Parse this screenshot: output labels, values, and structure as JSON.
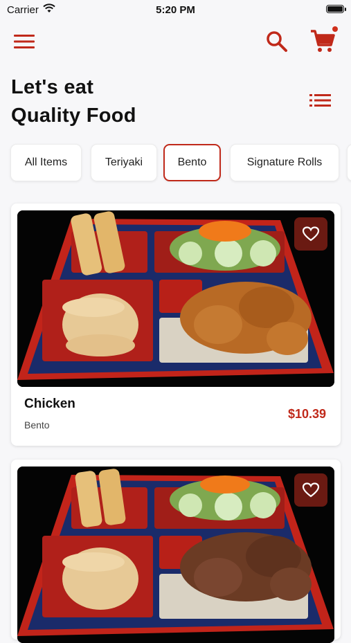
{
  "status_bar": {
    "carrier": "Carrier",
    "time": "5:20 PM"
  },
  "header": {
    "menu_icon": "hamburger-menu-icon",
    "search_icon": "search-icon",
    "cart_icon": "cart-icon",
    "list_icon": "list-view-icon",
    "title_line1": "Let's eat",
    "title_line2": "Quality Food"
  },
  "categories": [
    {
      "label": "All Items",
      "active": false
    },
    {
      "label": "Teriyaki",
      "active": false
    },
    {
      "label": "Bento",
      "active": true
    },
    {
      "label": "Signature Rolls",
      "active": false
    }
  ],
  "items": [
    {
      "name": "Chicken",
      "category": "Bento",
      "price": "$10.39",
      "image": "chicken-bento-image"
    },
    {
      "name": "",
      "category": "",
      "price": "",
      "image": "bento-image"
    }
  ],
  "colors": {
    "accent": "#c0291a",
    "fav_bg": "#6a1a12",
    "background": "#f7f7f9"
  }
}
